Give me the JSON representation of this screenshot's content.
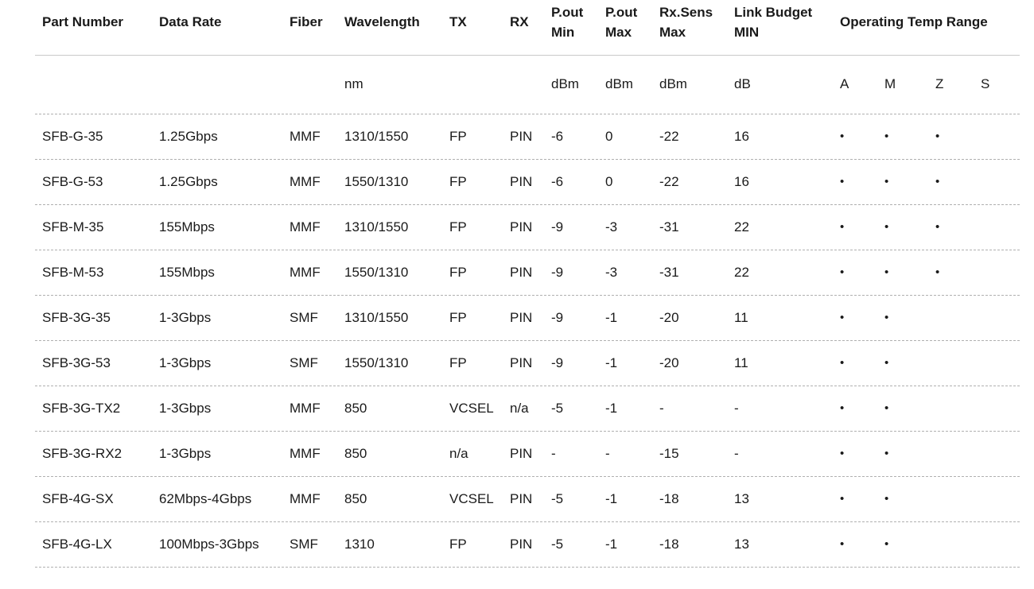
{
  "headers": [
    [
      "Part Number"
    ],
    [
      "Data Rate"
    ],
    [
      "Fiber"
    ],
    [
      "Wavelength"
    ],
    [
      "TX"
    ],
    [
      "RX"
    ],
    [
      "P.out",
      "Min"
    ],
    [
      "P.out",
      "Max"
    ],
    [
      "Rx.Sens",
      "Max"
    ],
    [
      "Link Budget",
      "MIN"
    ]
  ],
  "temp_header": "Operating Temp Range",
  "units": [
    "",
    "",
    "",
    "nm",
    "",
    "",
    "dBm",
    "dBm",
    "dBm",
    "dB"
  ],
  "temp_units": [
    "A",
    "M",
    "Z",
    "S"
  ],
  "bullet": "•",
  "rows": [
    {
      "cells": [
        "SFB-G-35",
        "1.25Gbps",
        "MMF",
        "1310/1550",
        "FP",
        "PIN",
        "-6",
        "0",
        "-22",
        "16"
      ],
      "temps": [
        true,
        true,
        true,
        false
      ]
    },
    {
      "cells": [
        "SFB-G-53",
        "1.25Gbps",
        "MMF",
        "1550/1310",
        "FP",
        "PIN",
        "-6",
        "0",
        "-22",
        "16"
      ],
      "temps": [
        true,
        true,
        true,
        false
      ]
    },
    {
      "cells": [
        "SFB-M-35",
        "155Mbps",
        "MMF",
        "1310/1550",
        "FP",
        "PIN",
        "-9",
        "-3",
        "-31",
        "22"
      ],
      "temps": [
        true,
        true,
        true,
        false
      ]
    },
    {
      "cells": [
        "SFB-M-53",
        "155Mbps",
        "MMF",
        "1550/1310",
        "FP",
        "PIN",
        "-9",
        "-3",
        "-31",
        "22"
      ],
      "temps": [
        true,
        true,
        true,
        false
      ]
    },
    {
      "cells": [
        "SFB-3G-35",
        "1-3Gbps",
        "SMF",
        "1310/1550",
        "FP",
        "PIN",
        "-9",
        "-1",
        "-20",
        "11"
      ],
      "temps": [
        true,
        true,
        false,
        false
      ]
    },
    {
      "cells": [
        "SFB-3G-53",
        "1-3Gbps",
        "SMF",
        "1550/1310",
        "FP",
        "PIN",
        "-9",
        "-1",
        "-20",
        "11"
      ],
      "temps": [
        true,
        true,
        false,
        false
      ]
    },
    {
      "cells": [
        "SFB-3G-TX2",
        "1-3Gbps",
        "MMF",
        "850",
        "VCSEL",
        "n/a",
        "-5",
        "-1",
        "-",
        "-"
      ],
      "temps": [
        true,
        true,
        false,
        false
      ]
    },
    {
      "cells": [
        "SFB-3G-RX2",
        "1-3Gbps",
        "MMF",
        "850",
        "n/a",
        "PIN",
        "-",
        "-",
        "-15",
        "-"
      ],
      "temps": [
        true,
        true,
        false,
        false
      ]
    },
    {
      "cells": [
        "SFB-4G-SX",
        "62Mbps-4Gbps",
        "MMF",
        "850",
        "VCSEL",
        "PIN",
        "-5",
        "-1",
        "-18",
        "13"
      ],
      "temps": [
        true,
        true,
        false,
        false
      ]
    },
    {
      "cells": [
        "SFB-4G-LX",
        "100Mbps-3Gbps",
        "SMF",
        "1310",
        "FP",
        "PIN",
        "-5",
        "-1",
        "-18",
        "13"
      ],
      "temps": [
        true,
        true,
        false,
        false
      ]
    }
  ]
}
